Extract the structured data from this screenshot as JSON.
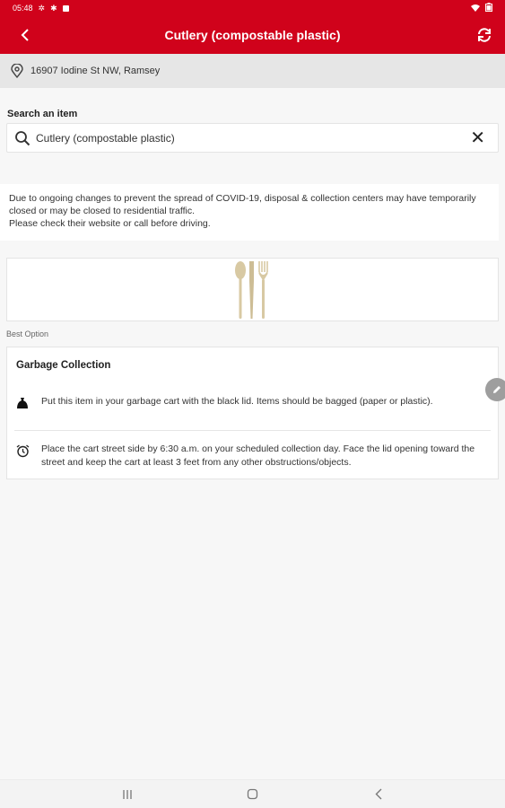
{
  "status_bar": {
    "time": "05:48"
  },
  "app_bar": {
    "title": "Cutlery (compostable plastic)"
  },
  "location": {
    "address": "16907 Iodine St NW, Ramsey"
  },
  "search": {
    "label": "Search an item",
    "value": "Cutlery (compostable plastic)",
    "clear": "✕"
  },
  "notice": {
    "line1": "Due to ongoing changes to prevent the spread of COVID-19, disposal & collection centers may have temporarily closed or may be closed to residential traffic.",
    "line2": "Please check their website or call before driving."
  },
  "best_option": {
    "label": "Best Option",
    "title": "Garbage Collection",
    "steps": [
      {
        "icon": "garbage-bag-icon",
        "text": "Put this item in your garbage cart with the black lid. Items should be bagged (paper or plastic)."
      },
      {
        "icon": "alarm-clock-icon",
        "text": "Place the cart street side by 6:30 a.m. on your scheduled collection day. Face the lid opening toward the street and keep the cart at least 3 feet from any other obstructions/objects."
      }
    ]
  },
  "colors": {
    "brand": "#d0021b",
    "background": "#f7f7f7",
    "card": "#ffffff",
    "cutlery": "#d8c9a3"
  },
  "nav_bar": {
    "recents": "|||",
    "home": "○",
    "back": "<"
  }
}
